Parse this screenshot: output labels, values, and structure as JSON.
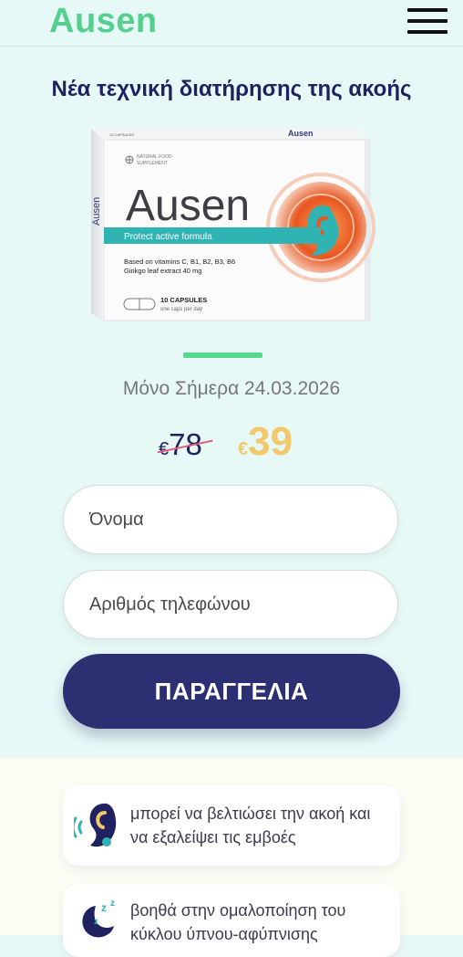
{
  "header": {
    "logo": "Ausen",
    "menu_icon": "hamburger-menu-icon"
  },
  "headline": "Νέα τεχνική διατήρησης της ακοής",
  "product": {
    "brand": "Ausen",
    "topline": "Ausen",
    "badge_line1": "NATURAL FOOD",
    "badge_line2": "SUPPLEMENT",
    "tagline": "Protect active formula",
    "vitamins_line": "Based on vitamins C, B1, B2, B3, B6",
    "ginkgo_line": "Ginkgo leaf extract 40 mg",
    "capsules": "10 CAPSULES",
    "dosage": "one caps per day",
    "side_text": "Ausen",
    "side_caps": "10 CAPSULES"
  },
  "offer": {
    "today_text": "Μόνο Σήμερα 24.03.2026",
    "old_currency": "€",
    "old_price": "78",
    "new_currency": "€",
    "new_price": "39"
  },
  "form": {
    "name_placeholder": "Όνομα",
    "phone_placeholder": "Αριθμός τηλεφώνου",
    "order_label": "ΠΑΡΑΓΓΕΛΙΑ"
  },
  "benefits": [
    {
      "icon": "ear-sound-icon",
      "text": "μπορεί να βελτιώσει την ακοή και να εξαλείψει τις εμβοές"
    },
    {
      "icon": "sleep-moon-icon",
      "text": "βοηθά στην ομαλοποίηση του κύκλου ύπνου-αφύπνισης"
    }
  ],
  "colors": {
    "background": "#e6f9f7",
    "logo_green": "#55cf8d",
    "headline_navy": "#1f2160",
    "button_navy": "#2c3072",
    "price_gold": "#f3c86b",
    "strike_pink": "#e05a7c",
    "product_teal": "#2fb3b3",
    "ear_orange": "#e8561f"
  }
}
